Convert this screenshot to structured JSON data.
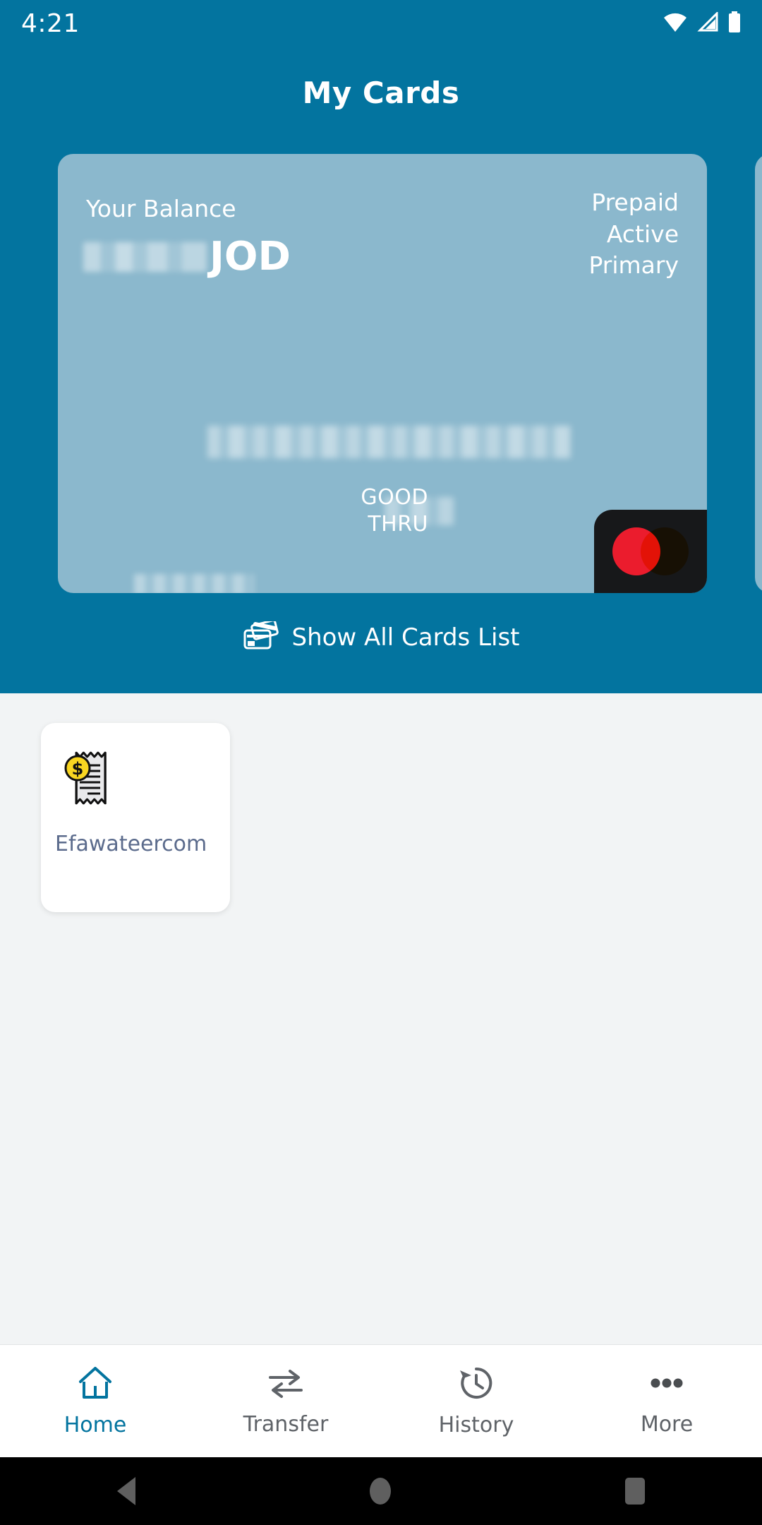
{
  "statusbar": {
    "time": "4:21",
    "icons": [
      "wifi-icon",
      "cellular-signal-icon",
      "battery-icon"
    ]
  },
  "appbar": {
    "title": "My Cards"
  },
  "card": {
    "balance_label": "Your Balance",
    "balance_amount_masked": "",
    "currency": "JOD",
    "status_lines": [
      "Prepaid",
      "Active",
      "Primary"
    ],
    "card_number_masked": "",
    "good_thru_line1": "GOOD",
    "good_thru_line2": "THRU",
    "expiry_masked": "",
    "holder_line1_masked": "",
    "holder_line2_masked": "",
    "network_logo": "mastercard-logo",
    "colors": {
      "card_bg": "#8bb8cd",
      "header_bg": "#03749f",
      "mastercard_red": "#eb1c2d",
      "mastercard_orange": "#f79e1b"
    }
  },
  "show_all_cards": {
    "label": "Show All Cards List",
    "icon": "cards-stack-icon"
  },
  "tiles": [
    {
      "label": "Efawateercom",
      "icon": "bill-receipt-icon"
    }
  ],
  "bottom_nav": {
    "items": [
      {
        "label": "Home",
        "icon": "home-icon",
        "active": true
      },
      {
        "label": "Transfer",
        "icon": "transfer-arrows-icon",
        "active": false
      },
      {
        "label": "History",
        "icon": "clock-history-icon",
        "active": false
      },
      {
        "label": "More",
        "icon": "more-dots-icon",
        "active": false
      }
    ],
    "active_color": "#03749f",
    "inactive_color": "#5f6368"
  },
  "android_nav": {
    "buttons": [
      "back-button",
      "home-button",
      "recents-button"
    ]
  }
}
